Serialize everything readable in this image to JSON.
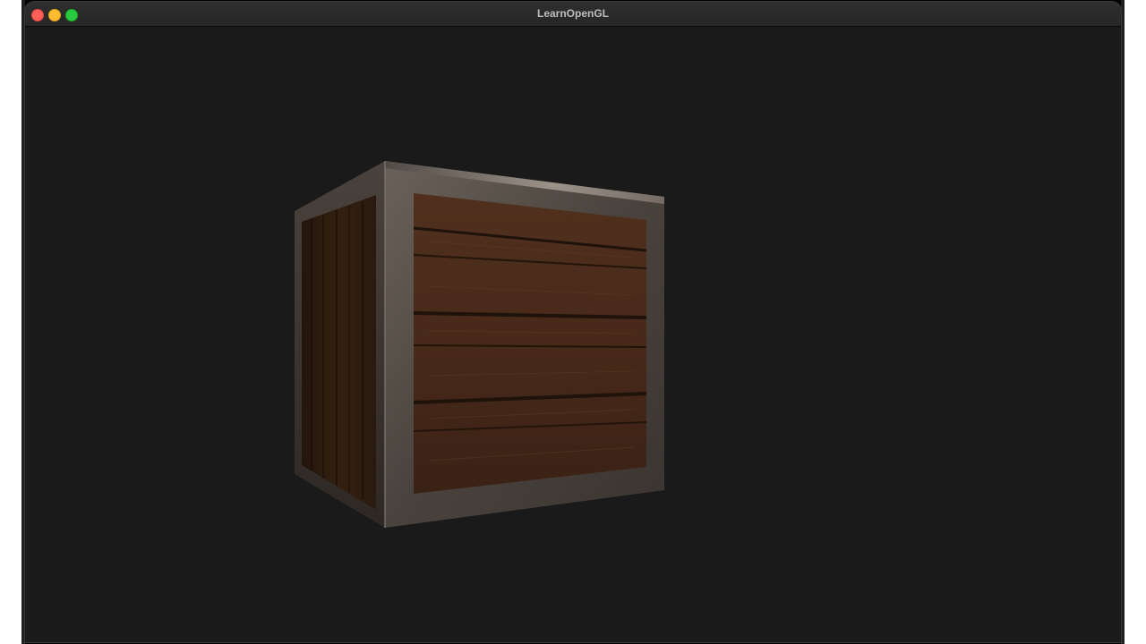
{
  "window": {
    "title": "LearnOpenGL",
    "controls": [
      "close",
      "minimize",
      "maximize"
    ],
    "colors": {
      "background": "#1a1a1a",
      "titlebar": "#2a2a2a",
      "close": "#ff5f57",
      "minimize": "#febc2e",
      "maximize": "#28c840"
    }
  },
  "scene": {
    "object": "wooden-crate-cube",
    "colors": {
      "wood_dark": "#2e1c12",
      "wood_mid": "#4a2e1e",
      "wood_light": "#5e3c28",
      "metal_frame": "#4a4440",
      "metal_highlight": "#9a928a"
    }
  }
}
